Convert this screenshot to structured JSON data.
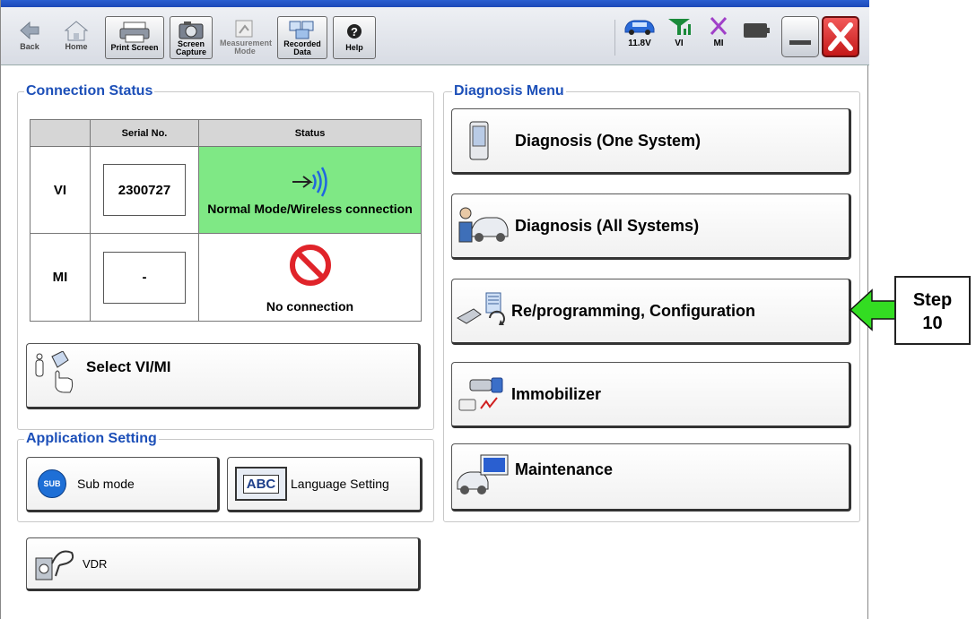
{
  "toolbar": {
    "back": "Back",
    "home": "Home",
    "print_screen": "Print Screen",
    "screen_capture_1": "Screen",
    "screen_capture_2": "Capture",
    "measurement_1": "Measurement",
    "measurement_2": "Mode",
    "recorded_1": "Recorded",
    "recorded_2": "Data",
    "help": "Help",
    "voltage": "11.8V",
    "vi": "VI",
    "mi": "MI"
  },
  "connection_status": {
    "title": "Connection Status",
    "col_serial": "Serial No.",
    "col_status": "Status",
    "rows": [
      {
        "label": "VI",
        "serial": "2300727",
        "status": "Normal Mode/Wireless connection"
      },
      {
        "label": "MI",
        "serial": "-",
        "status": "No connection"
      }
    ]
  },
  "select_vimi": "Select VI/MI",
  "application_setting": {
    "title": "Application Setting",
    "sub_mode": "Sub mode",
    "sub_icon_text": "SUB",
    "language": "Language Setting",
    "abc": "ABC"
  },
  "vdr": "VDR",
  "diagnosis_menu": {
    "title": "Diagnosis Menu",
    "items": [
      "Diagnosis (One System)",
      "Diagnosis (All Systems)",
      "Re/programming, Configuration",
      "Immobilizer",
      "Maintenance"
    ]
  },
  "callout": {
    "line1": "Step",
    "line2": "10",
    "arrow_color": "#33dd22"
  },
  "colors": {
    "group_title": "#1c4fb8",
    "status_ok": "#7fe885",
    "close_red": "#e0242a"
  }
}
